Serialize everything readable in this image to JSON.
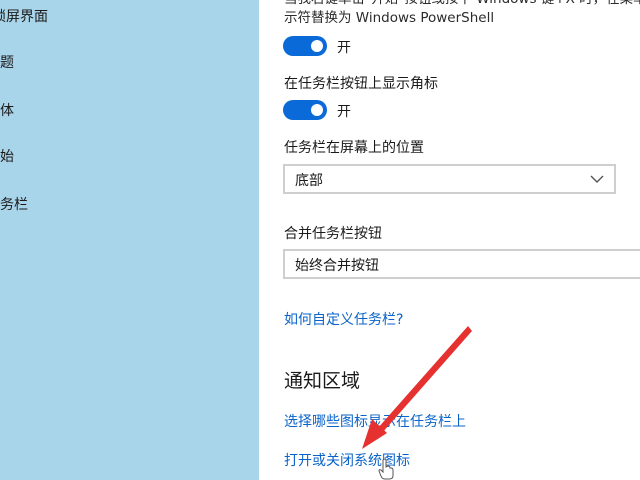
{
  "sidebar": {
    "items": [
      {
        "label": "锁屏界面"
      },
      {
        "label": "主题"
      },
      {
        "label": "字体"
      },
      {
        "label": "开始"
      },
      {
        "label": "任务栏"
      }
    ]
  },
  "settings": {
    "powershell_desc_line1": "当我右键单击\"开始\"按钮或按下 Windows 键+X 时，在菜单",
    "powershell_desc_line2": "示符替换为 Windows PowerShell",
    "powershell_toggle_state": "开",
    "badges_label": "在任务栏按钮上显示角标",
    "badges_toggle_state": "开",
    "location_label": "任务栏在屏幕上的位置",
    "location_value": "底部",
    "combine_label": "合并任务栏按钮",
    "combine_value": "始终合并按钮",
    "customize_link": "如何自定义任务栏?",
    "notification_title": "通知区域",
    "select_icons_link": "选择哪些图标显示在任务栏上",
    "system_icons_link": "打开或关闭系统图标"
  },
  "colors": {
    "sidebar_bg": "#a9d5ea",
    "toggle_on": "#0a6ad8",
    "link": "#0a63c9",
    "annotation_arrow": "#e5312f"
  }
}
